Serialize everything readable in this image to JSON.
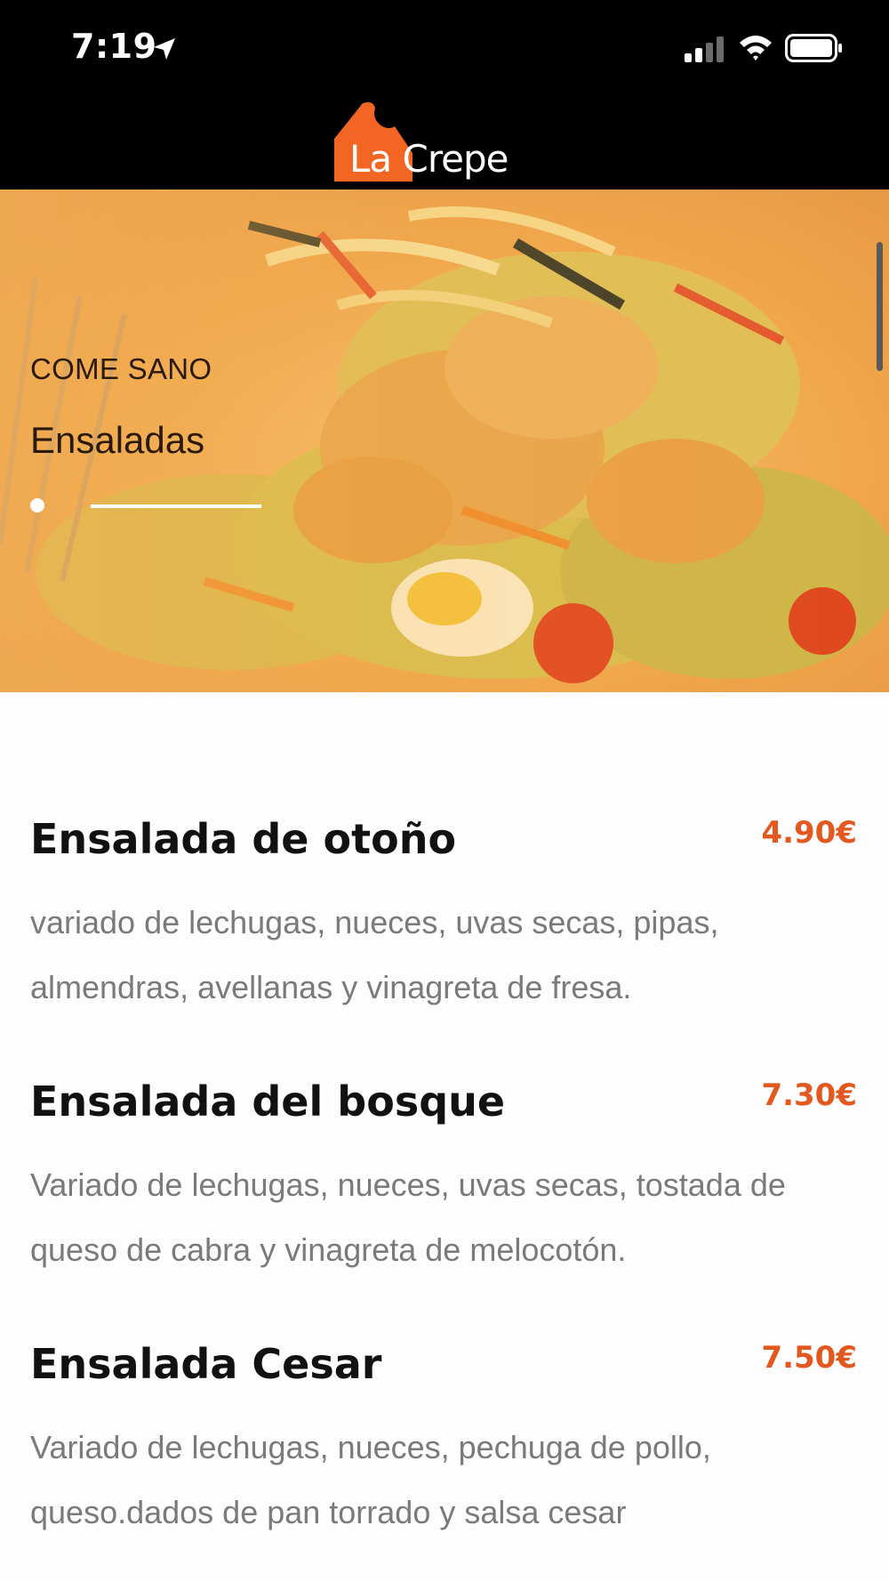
{
  "status_bar": {
    "time": "7:19",
    "icons": [
      "location-arrow-icon",
      "signal-icon",
      "wifi-icon",
      "battery-icon"
    ]
  },
  "header": {
    "logo_text_a": "La",
    "logo_text_b": " Crepe",
    "logo_color": "#f26522"
  },
  "hero": {
    "kicker": "COME SANO",
    "title": "Ensaladas"
  },
  "menu_items": [
    {
      "name": "Ensalada de otoño",
      "price": "4.90€",
      "description": "variado de lechugas, nueces, uvas secas, pipas, almendras, avellanas y vinagreta de fresa."
    },
    {
      "name": "Ensalada del bosque",
      "price": "7.30€",
      "description": "Variado de lechugas, nueces, uvas secas, tostada de queso de cabra y vinagreta de melocotón."
    },
    {
      "name": "Ensalada Cesar",
      "price": "7.50€",
      "description": "Variado de lechugas, nueces, pechuga de pollo, queso.dados de pan torrado y salsa cesar"
    }
  ],
  "colors": {
    "accent": "#e2581f",
    "text_dark": "#111111",
    "text_muted": "#7a7a7a"
  }
}
